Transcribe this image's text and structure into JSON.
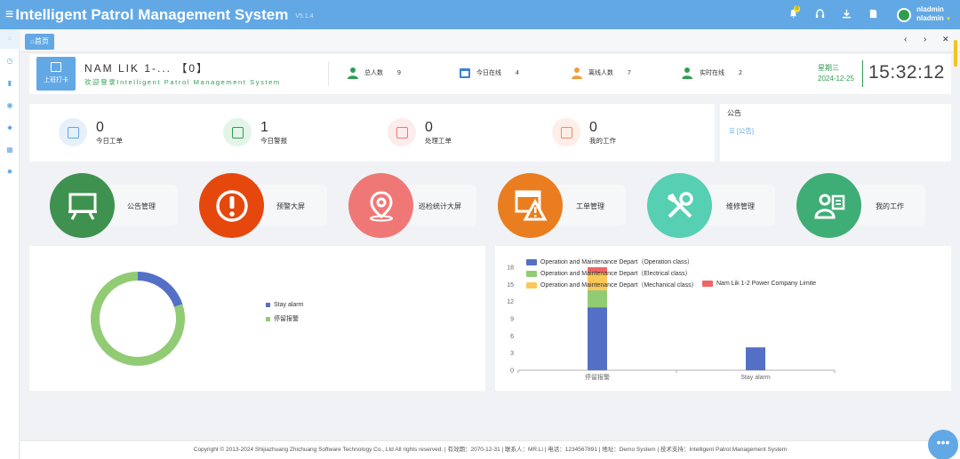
{
  "header": {
    "title": "Intelligent Patrol Management System",
    "version": "V5.1.4",
    "notification_count": "0",
    "username": "nladmin",
    "username2": "nladmin"
  },
  "tabs": {
    "home": "首页"
  },
  "welcome": {
    "punch_label": "上班打卡",
    "user_line": "NAM LIK 1-... 【0】",
    "welcome_text": "欢迎登录Intelligent Patrol Management System",
    "stats": [
      {
        "label": "总人数",
        "value": "9"
      },
      {
        "label": "今日在线",
        "value": "4"
      },
      {
        "label": "离线人数",
        "value": "7"
      },
      {
        "label": "实时在线",
        "value": "2"
      }
    ],
    "weekday": "星期三",
    "date": "2024-12-25",
    "time": "15:32:12"
  },
  "summary": [
    {
      "value": "0",
      "label": "今日工单"
    },
    {
      "value": "1",
      "label": "今日警报"
    },
    {
      "value": "0",
      "label": "处理工单"
    },
    {
      "value": "0",
      "label": "我的工作"
    }
  ],
  "notice": {
    "title": "公告",
    "link": "[公告]"
  },
  "modules": [
    {
      "label": "公告管理",
      "color": "#3f9150",
      "icon": "presentation-board-icon"
    },
    {
      "label": "预警大屏",
      "color": "#e6470d",
      "icon": "alert-icon"
    },
    {
      "label": "巡检统计大屏",
      "color": "#ef7876",
      "icon": "location-pin-icon"
    },
    {
      "label": "工单管理",
      "color": "#ea7d1f",
      "icon": "warning-window-icon"
    },
    {
      "label": "维修管理",
      "color": "#56cfb2",
      "icon": "tools-icon"
    },
    {
      "label": "我的工作",
      "color": "#3fad76",
      "icon": "user-list-icon"
    }
  ],
  "chart_data": [
    {
      "type": "pie",
      "subtype": "donut",
      "labels": [
        "Stay alarm",
        "停留报警"
      ],
      "values": [
        1,
        4
      ],
      "colors": [
        "#5470c6",
        "#91cc75"
      ]
    },
    {
      "type": "bar",
      "stacked": true,
      "categories": [
        "停留报警",
        "Stay alarm"
      ],
      "ylim": [
        0,
        18
      ],
      "yticks": [
        "0",
        "3",
        "6",
        "9",
        "12",
        "15",
        "18"
      ],
      "series": [
        {
          "name": "Operation and Maintenance Depart（Operation class）",
          "color": "#5470c6",
          "values": [
            11,
            4
          ]
        },
        {
          "name": "Operation and Maintenance Depart（Electrical class）",
          "color": "#91cc75",
          "values": [
            3,
            0
          ]
        },
        {
          "name": "Operation and Maintenance Depart（Mechanical class）",
          "color": "#fac858",
          "values": [
            3,
            0
          ]
        },
        {
          "name": "Nam Lik 1-2 Power Company Limite",
          "color": "#ee6666",
          "values": [
            1,
            0
          ]
        }
      ]
    }
  ],
  "footer": {
    "text": "Copyright © 2013-2024 Shijiazhuang Zhichuang Software Technology Co., Ltd All rights reserved.   |   有效期：2070-12-31   |   联系人：MR.Li   |   电话：1234567891   |   地址：Demo System   |   技术支持：Intelligent Patrol Management System"
  }
}
